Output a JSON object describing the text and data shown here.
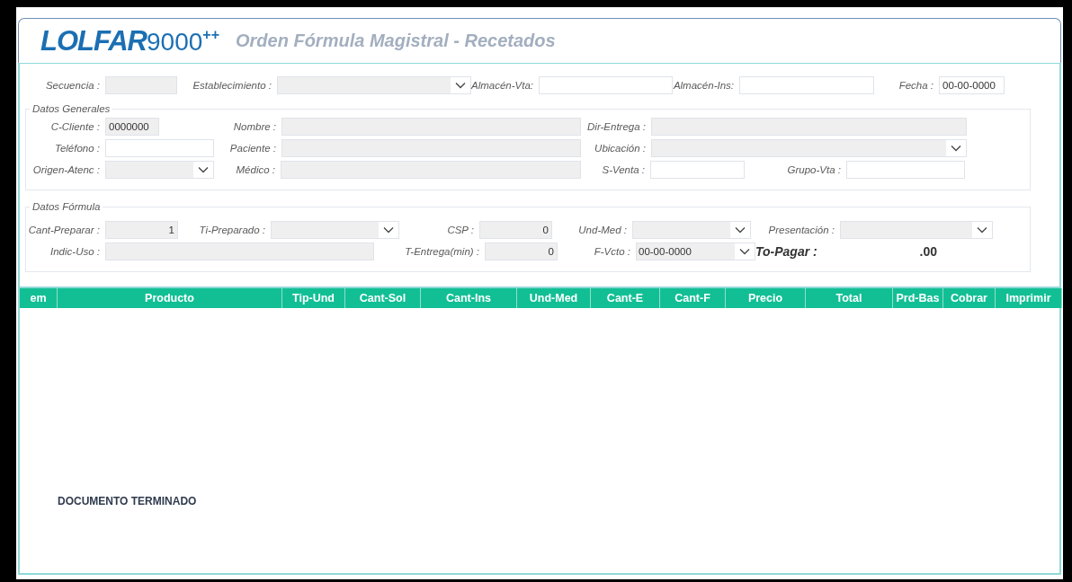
{
  "header": {
    "logo": "LOLFAR",
    "logo_number": "9000",
    "logo_suffix": "++",
    "title": "Orden Fórmula Magistral - Recetados"
  },
  "top_row": [
    {
      "label": "Secuencia :",
      "kind": "readonly"
    },
    {
      "label": "Establecimiento :",
      "kind": "select"
    },
    {
      "label": "Almacén-Vta:",
      "kind": "text"
    },
    {
      "label": "Almacén-Ins:",
      "kind": "text"
    },
    {
      "label": "Fecha :",
      "kind": "text",
      "value": "00-00-0000"
    }
  ],
  "sections": [
    {
      "legend": "Datos Generales",
      "rows": [
        [
          {
            "label": "C-Cliente :",
            "kind": "readonly",
            "value": "0000000"
          },
          {
            "label": "Nombre :",
            "kind": "readonly"
          },
          {
            "label": "Dir-Entrega :",
            "kind": "readonly"
          }
        ],
        [
          {
            "label": "Teléfono :",
            "kind": "text"
          },
          {
            "label": "Paciente :",
            "kind": "readonly"
          },
          {
            "label": "Ubicación :",
            "kind": "select"
          }
        ],
        [
          {
            "label": "Origen-Atenc :",
            "kind": "select"
          },
          {
            "label": "Médico :",
            "kind": "readonly"
          },
          {
            "label": "S-Venta :",
            "kind": "text"
          },
          {
            "label": "Grupo-Vta :",
            "kind": "text"
          }
        ]
      ]
    },
    {
      "legend": "Datos Fórmula",
      "rows": [
        [
          {
            "label": "Cant-Preparar :",
            "kind": "number",
            "value": "1"
          },
          {
            "label": "Ti-Preparado :",
            "kind": "select"
          },
          {
            "label": "CSP :",
            "kind": "number",
            "value": "0"
          },
          {
            "label": "Und-Med :",
            "kind": "select"
          },
          {
            "label": "Presentación :",
            "kind": "select"
          }
        ],
        [
          {
            "label": "Indic-Uso :",
            "kind": "readonly"
          },
          null,
          {
            "label": "T-Entrega(min) :",
            "kind": "number",
            "value": "0"
          },
          {
            "label": "F-Vcto :",
            "kind": "select",
            "value": "00-00-0000"
          },
          {
            "label": "To-Pagar :",
            "kind": "total",
            "value": ".00"
          }
        ]
      ]
    }
  ],
  "table": {
    "columns": [
      "em",
      "Producto",
      "Tip-Und",
      "Cant-Sol",
      "Cant-Ins",
      "Und-Med",
      "Cant-E",
      "Cant-F",
      "Precio",
      "Total",
      "Prd-Bas",
      "Cobrar",
      "Imprimir"
    ]
  },
  "status": "DOCUMENTO TERMINADO"
}
